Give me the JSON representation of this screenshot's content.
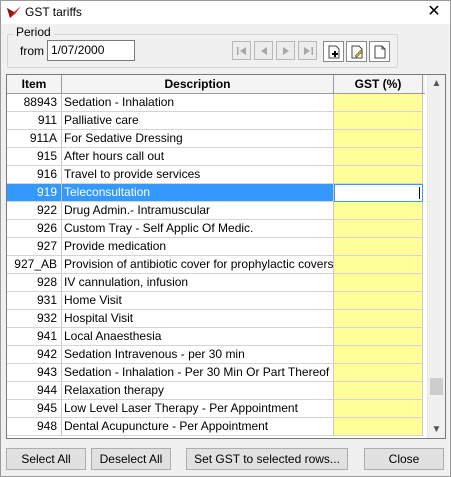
{
  "window": {
    "title": "GST tariffs"
  },
  "period": {
    "label": "Period",
    "from_label": "from",
    "from_value": "1/07/2000"
  },
  "grid": {
    "columns": [
      "Item",
      "Description",
      "GST (%)"
    ],
    "selected_index": 5,
    "rows": [
      {
        "item": "88943",
        "description": "Sedation - Inhalation",
        "gst": ""
      },
      {
        "item": "911",
        "description": "Palliative care",
        "gst": ""
      },
      {
        "item": "911A",
        "description": "For Sedative Dressing",
        "gst": ""
      },
      {
        "item": "915",
        "description": "After hours call out",
        "gst": ""
      },
      {
        "item": "916",
        "description": "Travel to provide services",
        "gst": ""
      },
      {
        "item": "919",
        "description": "Teleconsultation",
        "gst": ""
      },
      {
        "item": "922",
        "description": "Drug Admin.- Intramuscular",
        "gst": ""
      },
      {
        "item": "926",
        "description": "Custom Tray - Self Applic Of Medic.",
        "gst": ""
      },
      {
        "item": "927",
        "description": "Provide medication",
        "gst": ""
      },
      {
        "item": "927_AB",
        "description": "Provision of antibiotic cover for prophylactic covers",
        "gst": ""
      },
      {
        "item": "928",
        "description": "IV cannulation, infusion",
        "gst": ""
      },
      {
        "item": "931",
        "description": "Home Visit",
        "gst": ""
      },
      {
        "item": "932",
        "description": "Hospital Visit",
        "gst": ""
      },
      {
        "item": "941",
        "description": "Local Anaesthesia",
        "gst": ""
      },
      {
        "item": "942",
        "description": "Sedation Intravenous - per 30 min",
        "gst": ""
      },
      {
        "item": "943",
        "description": "Sedation  - Inhalation - Per 30 Min Or Part Thereof",
        "gst": ""
      },
      {
        "item": "944",
        "description": "Relaxation therapy",
        "gst": ""
      },
      {
        "item": "945",
        "description": "Low Level Laser Therapy - Per Appointment",
        "gst": ""
      },
      {
        "item": "948",
        "description": "Dental Acupuncture - Per Appointment",
        "gst": ""
      }
    ]
  },
  "buttons": {
    "select_all": "Select All",
    "deselect_all": "Deselect All",
    "set_gst": "Set GST to selected rows...",
    "close": "Close"
  },
  "colors": {
    "gst_cell": "#ffff99",
    "selection": "#3399ff"
  }
}
